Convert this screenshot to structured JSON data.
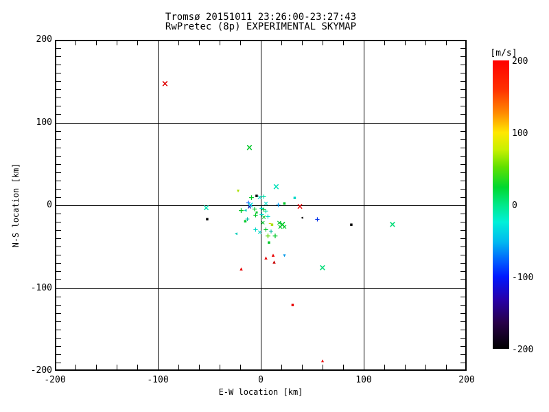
{
  "header": {
    "title_line1": "Tromsø 20151011 23:26:00-23:27:43",
    "title_line2": "RwPretec (8p) EXPERIMENTAL SKYMAP"
  },
  "chart_data": {
    "type": "scatter",
    "title": "Tromsø 20151011 23:26:00-23:27:43",
    "subtitle": "RwPretec (8p) EXPERIMENTAL SKYMAP",
    "xlabel": "E-W location [km]",
    "ylabel": "N-S location [km]",
    "xlim": [
      -200,
      200
    ],
    "ylim": [
      -200,
      200
    ],
    "x_major_ticks": [
      -200,
      -100,
      0,
      100,
      200
    ],
    "y_major_ticks": [
      -200,
      -100,
      0,
      100,
      200
    ],
    "x_minor_step": 20,
    "y_minor_step": 10,
    "grid": "full-length solid gridlines at major ticks",
    "legend_position": "colorbar right",
    "colorbar": {
      "title": "[m/s]",
      "min": -200,
      "max": 200,
      "ticks": [
        200,
        100,
        0,
        -100,
        -200
      ],
      "stops": [
        {
          "pos": 0.0,
          "color": "#ff0000"
        },
        {
          "pos": 0.1,
          "color": "#ff3000"
        },
        {
          "pos": 0.18,
          "color": "#ff8800"
        },
        {
          "pos": 0.25,
          "color": "#ffe800"
        },
        {
          "pos": 0.31,
          "color": "#c8f000"
        },
        {
          "pos": 0.37,
          "color": "#60e000"
        },
        {
          "pos": 0.44,
          "color": "#00d830"
        },
        {
          "pos": 0.5,
          "color": "#00e888"
        },
        {
          "pos": 0.56,
          "color": "#00f0d8"
        },
        {
          "pos": 0.63,
          "color": "#00b8f0"
        },
        {
          "pos": 0.7,
          "color": "#0058ff"
        },
        {
          "pos": 0.75,
          "color": "#0018ff"
        },
        {
          "pos": 0.83,
          "color": "#2800a8"
        },
        {
          "pos": 0.91,
          "color": "#280048"
        },
        {
          "pos": 1.0,
          "color": "#000000"
        }
      ]
    },
    "points": [
      {
        "x": -93,
        "y": 146,
        "v": 190,
        "color": "#e00000",
        "glyph": "x",
        "size": 13
      },
      {
        "x": -11,
        "y": 69,
        "v": 55,
        "color": "#00c828",
        "glyph": "x",
        "size": 13
      },
      {
        "x": 15,
        "y": 22,
        "v": -5,
        "color": "#00e0b8",
        "glyph": "x",
        "size": 13
      },
      {
        "x": -22,
        "y": 17,
        "v": 80,
        "color": "#a8e000",
        "glyph": "tdn",
        "size": 8
      },
      {
        "x": -53,
        "y": -3,
        "v": -5,
        "color": "#00e0b0",
        "glyph": "x",
        "size": 12
      },
      {
        "x": -52,
        "y": -17,
        "v": -190,
        "color": "#000000",
        "glyph": "dot",
        "size": 7
      },
      {
        "x": -9,
        "y": 9,
        "v": 55,
        "color": "#00c828",
        "glyph": "plus",
        "size": 11
      },
      {
        "x": -4,
        "y": 11,
        "v": -190,
        "color": "#000000",
        "glyph": "dot",
        "size": 7
      },
      {
        "x": -1,
        "y": 8,
        "v": -10,
        "color": "#00d8c8",
        "glyph": "x",
        "size": 10
      },
      {
        "x": 3,
        "y": 9,
        "v": -5,
        "color": "#00e0a8",
        "glyph": "plus",
        "size": 10
      },
      {
        "x": 33,
        "y": 8,
        "v": -10,
        "color": "#00d8c8",
        "glyph": "dot",
        "size": 7
      },
      {
        "x": 23,
        "y": 2,
        "v": 55,
        "color": "#00c828",
        "glyph": "dot",
        "size": 7
      },
      {
        "x": -12,
        "y": 2,
        "v": -80,
        "color": "#0048ff",
        "glyph": "plus",
        "size": 10
      },
      {
        "x": -10,
        "y": 0,
        "v": -15,
        "color": "#00e0e0",
        "glyph": "x",
        "size": 12
      },
      {
        "x": -11,
        "y": -3,
        "v": -130,
        "color": "#0000b0",
        "glyph": "x",
        "size": 9
      },
      {
        "x": 38,
        "y": -2,
        "v": 190,
        "color": "#e80000",
        "glyph": "x",
        "size": 12
      },
      {
        "x": 17,
        "y": -1,
        "v": -40,
        "color": "#00a0ff",
        "glyph": "plus",
        "size": 10
      },
      {
        "x": -15,
        "y": -7,
        "v": -15,
        "color": "#00ccb8",
        "glyph": "left",
        "size": 8
      },
      {
        "x": -19,
        "y": -7,
        "v": 55,
        "color": "#00c828",
        "glyph": "plus",
        "size": 11
      },
      {
        "x": -6,
        "y": -6,
        "v": 55,
        "color": "#00c828",
        "glyph": "plus",
        "size": 10
      },
      {
        "x": 1,
        "y": -5,
        "v": -10,
        "color": "#00d8c8",
        "glyph": "plus",
        "size": 10
      },
      {
        "x": 3,
        "y": -7,
        "v": 55,
        "color": "#00c828",
        "glyph": "plus",
        "size": 10
      },
      {
        "x": 5,
        "y": 1,
        "v": -10,
        "color": "#00d8c8",
        "glyph": "x",
        "size": 9
      },
      {
        "x": 5,
        "y": -8,
        "v": -5,
        "color": "#00e0a8",
        "glyph": "plus",
        "size": 10
      },
      {
        "x": -5,
        "y": -13,
        "v": 55,
        "color": "#00c828",
        "glyph": "plus",
        "size": 10
      },
      {
        "x": -4,
        "y": -9,
        "v": 55,
        "color": "#00c828",
        "glyph": "dot",
        "size": 6
      },
      {
        "x": 1,
        "y": -12,
        "v": -10,
        "color": "#00d8c8",
        "glyph": "plus",
        "size": 10
      },
      {
        "x": 3,
        "y": -16,
        "v": 55,
        "color": "#00c828",
        "glyph": "x",
        "size": 9
      },
      {
        "x": 7,
        "y": -15,
        "v": -10,
        "color": "#00d8c8",
        "glyph": "plus",
        "size": 10
      },
      {
        "x": -15,
        "y": -20,
        "v": 55,
        "color": "#00c828",
        "glyph": "dot",
        "size": 7
      },
      {
        "x": -13,
        "y": -18,
        "v": -20,
        "color": "#00c0a8",
        "glyph": "plus",
        "size": 9
      },
      {
        "x": 40,
        "y": -16,
        "v": -190,
        "color": "#000000",
        "glyph": "left",
        "size": 7
      },
      {
        "x": 55,
        "y": -18,
        "v": -90,
        "color": "#0030e8",
        "glyph": "plus",
        "size": 10
      },
      {
        "x": 88,
        "y": -24,
        "v": -190,
        "color": "#000000",
        "glyph": "dot",
        "size": 7
      },
      {
        "x": 128,
        "y": -24,
        "v": 30,
        "color": "#00dc78",
        "glyph": "x",
        "size": 13
      },
      {
        "x": 11,
        "y": -24,
        "v": 80,
        "color": "#a8e000",
        "glyph": "dot",
        "size": 7
      },
      {
        "x": 18,
        "y": -22,
        "v": 55,
        "color": "#00c828",
        "glyph": "x",
        "size": 10
      },
      {
        "x": 21,
        "y": -24,
        "v": 55,
        "color": "#00c828",
        "glyph": "x",
        "size": 14
      },
      {
        "x": 23,
        "y": -27,
        "v": 55,
        "color": "#00c828",
        "glyph": "x",
        "size": 10
      },
      {
        "x": 19,
        "y": -27,
        "v": 55,
        "color": "#00c828",
        "glyph": "x",
        "size": 10
      },
      {
        "x": 2,
        "y": -22,
        "v": 55,
        "color": "#00c828",
        "glyph": "x",
        "size": 9
      },
      {
        "x": 9,
        "y": -23,
        "v": 95,
        "color": "#d0d800",
        "glyph": "dash",
        "size": 9
      },
      {
        "x": -5,
        "y": -31,
        "v": -10,
        "color": "#00d8c8",
        "glyph": "plus",
        "size": 10
      },
      {
        "x": 5,
        "y": -31,
        "v": 55,
        "color": "#00c828",
        "glyph": "plus",
        "size": 10
      },
      {
        "x": -1,
        "y": -34,
        "v": -10,
        "color": "#00d8c8",
        "glyph": "x",
        "size": 9
      },
      {
        "x": 10,
        "y": -33,
        "v": -20,
        "color": "#00b898",
        "glyph": "plus",
        "size": 9
      },
      {
        "x": -24,
        "y": -35,
        "v": -15,
        "color": "#00ccb8",
        "glyph": "left",
        "size": 8
      },
      {
        "x": 7,
        "y": -37,
        "v": 70,
        "color": "#58d800",
        "glyph": "plus",
        "size": 11
      },
      {
        "x": 14,
        "y": -37,
        "v": 55,
        "color": "#00c828",
        "glyph": "plus",
        "size": 11
      },
      {
        "x": 8,
        "y": -46,
        "v": 55,
        "color": "#00c828",
        "glyph": "dot",
        "size": 7
      },
      {
        "x": 12,
        "y": -61,
        "v": 190,
        "color": "#e80000",
        "glyph": "tri",
        "size": 9
      },
      {
        "x": 23,
        "y": -61,
        "v": -45,
        "color": "#0098e8",
        "glyph": "tdn",
        "size": 8
      },
      {
        "x": 5,
        "y": -65,
        "v": 190,
        "color": "#e80000",
        "glyph": "tri",
        "size": 9
      },
      {
        "x": 13,
        "y": -70,
        "v": 180,
        "color": "#c80000",
        "glyph": "tri",
        "size": 9
      },
      {
        "x": -19,
        "y": -78,
        "v": 190,
        "color": "#e80000",
        "glyph": "tri",
        "size": 9
      },
      {
        "x": 60,
        "y": -76,
        "v": 30,
        "color": "#00dc78",
        "glyph": "x",
        "size": 13
      },
      {
        "x": 31,
        "y": -121,
        "v": 190,
        "color": "#e80000",
        "glyph": "dot",
        "size": 7
      },
      {
        "x": 60,
        "y": -188,
        "v": 190,
        "color": "#e80000",
        "glyph": "tri",
        "size": 8
      }
    ]
  }
}
